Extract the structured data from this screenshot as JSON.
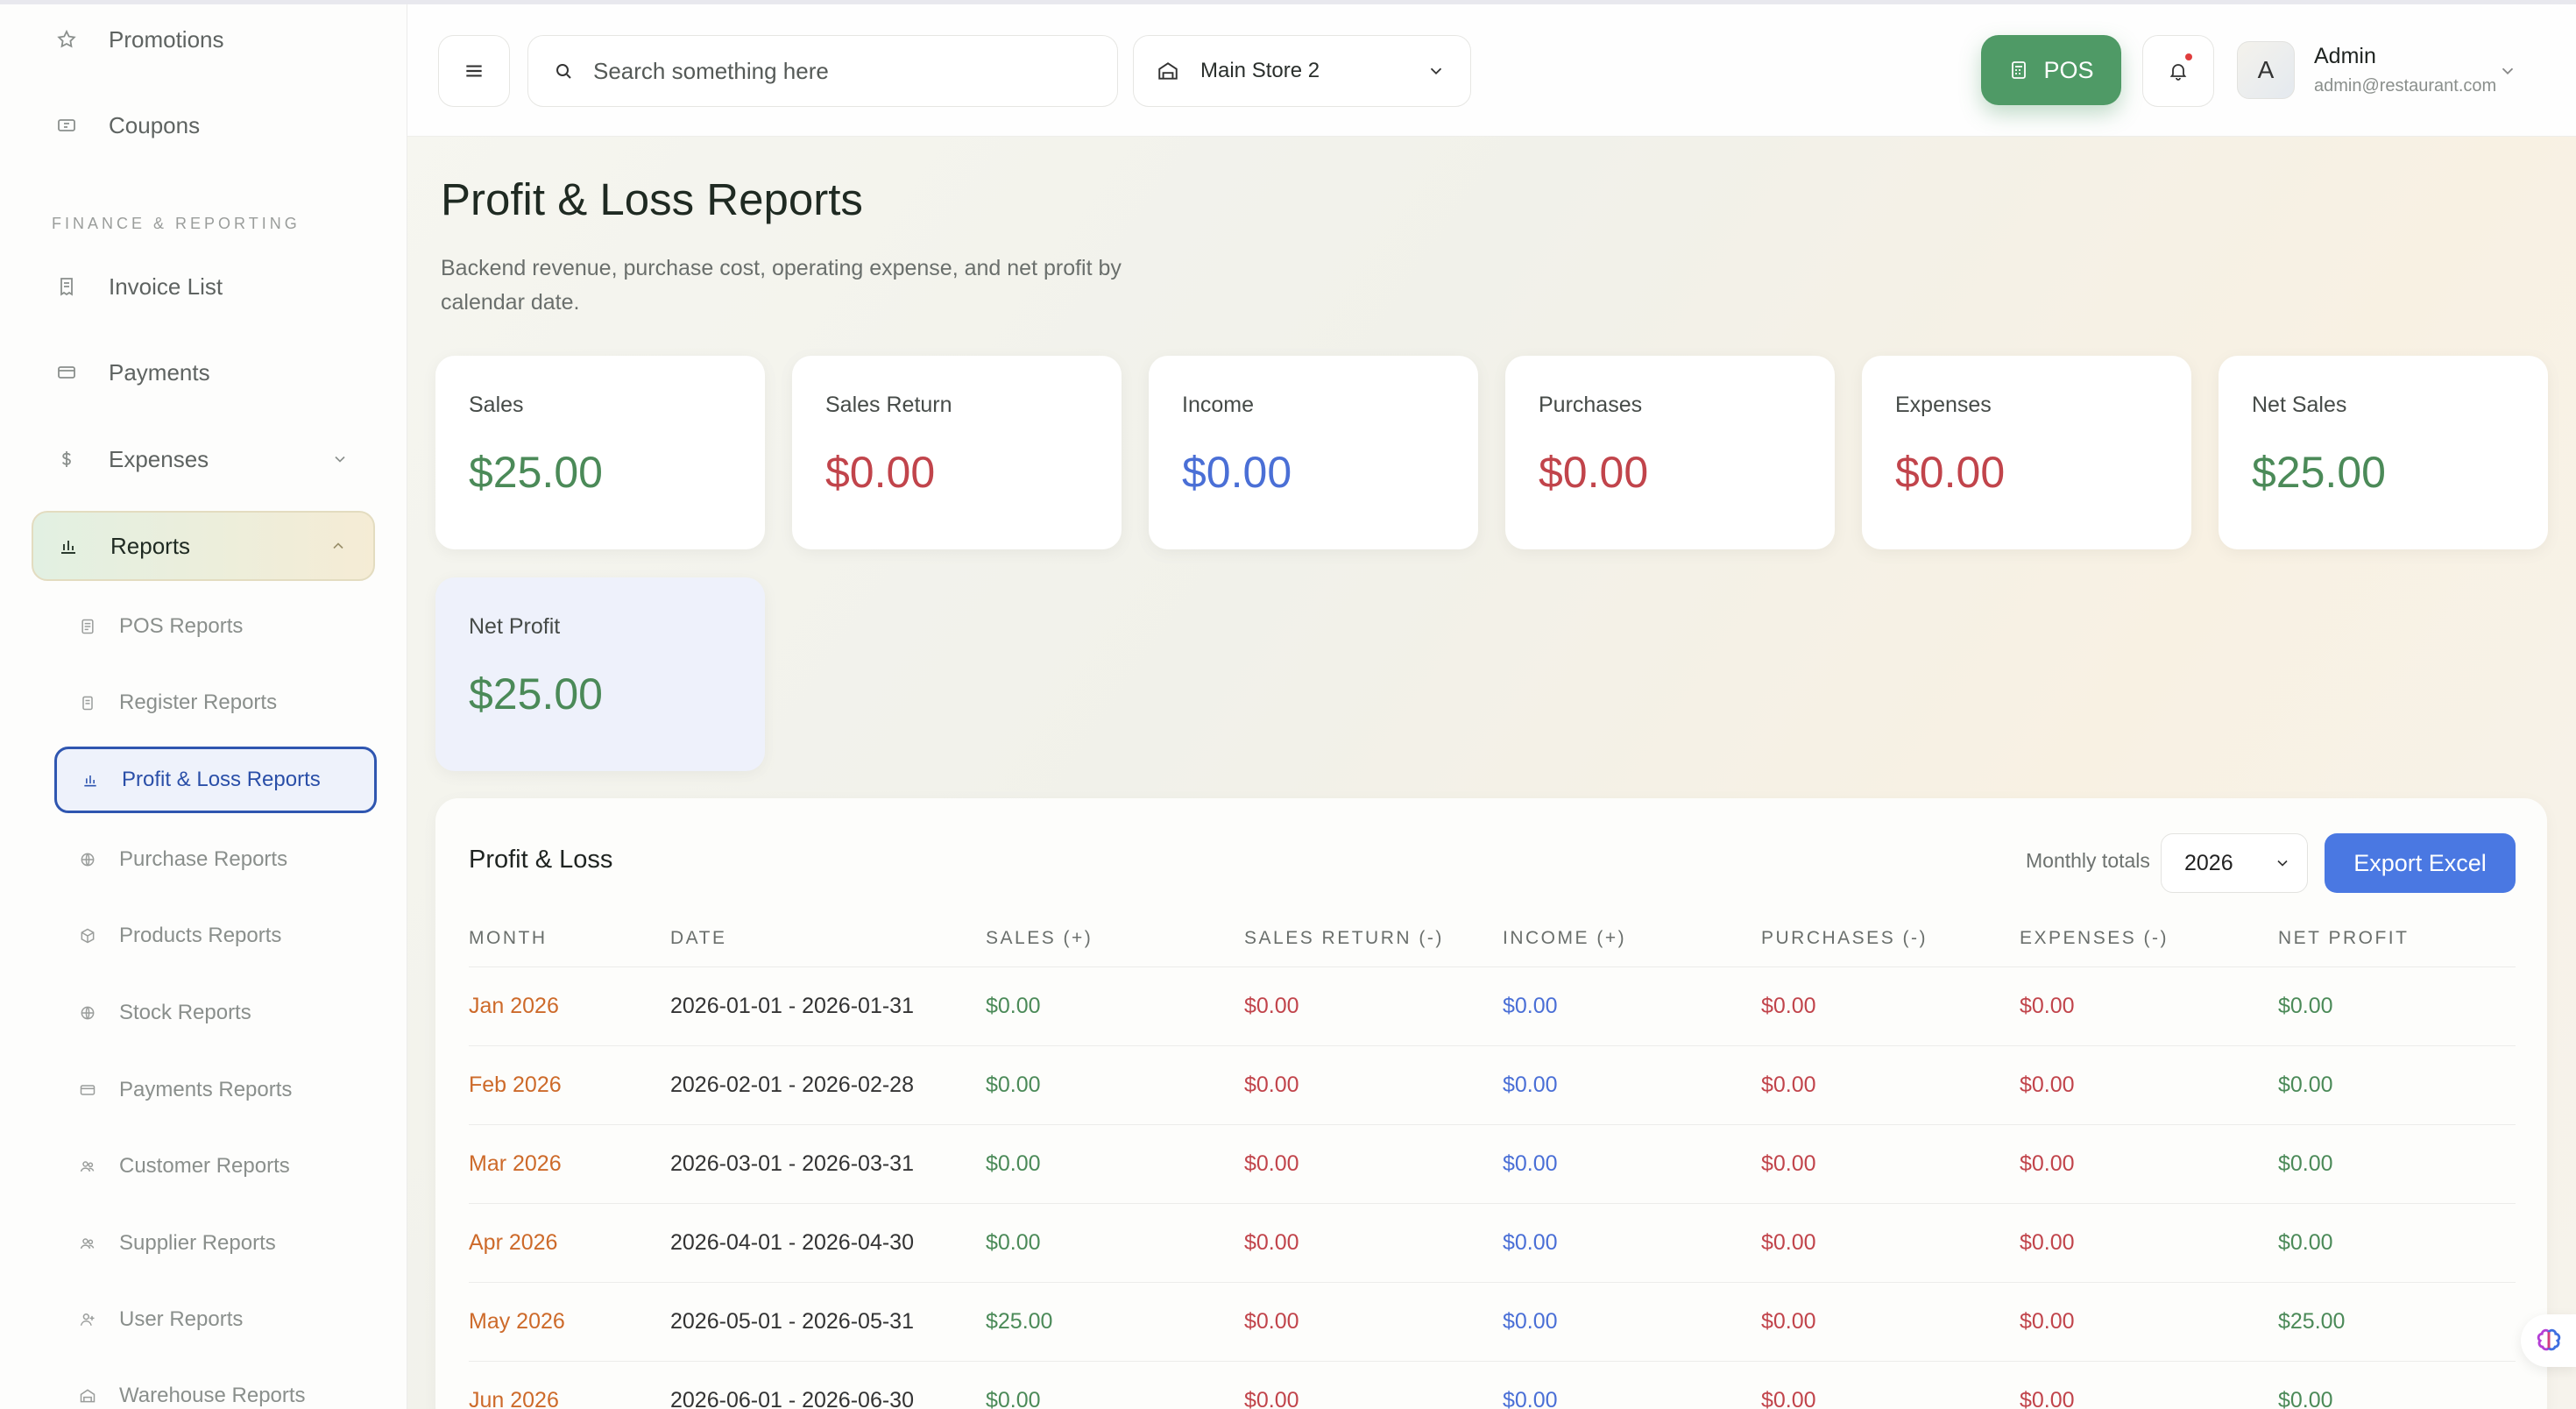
{
  "sidebar": {
    "top_items": [
      {
        "label": "Promotions",
        "icon": "star-icon"
      },
      {
        "label": "Coupons",
        "icon": "ticket-icon"
      }
    ],
    "section_title": "FINANCE & REPORTING",
    "items": [
      {
        "label": "Invoice List",
        "icon": "receipt-icon"
      },
      {
        "label": "Payments",
        "icon": "card-icon"
      },
      {
        "label": "Expenses",
        "icon": "dollar-icon"
      },
      {
        "label": "Reports",
        "icon": "bar-chart-icon"
      }
    ],
    "report_items": [
      {
        "label": "POS Reports"
      },
      {
        "label": "Register Reports"
      },
      {
        "label": "Profit & Loss Reports"
      },
      {
        "label": "Purchase Reports"
      },
      {
        "label": "Products Reports"
      },
      {
        "label": "Stock Reports"
      },
      {
        "label": "Payments Reports"
      },
      {
        "label": "Customer Reports"
      },
      {
        "label": "Supplier Reports"
      },
      {
        "label": "User Reports"
      },
      {
        "label": "Warehouse Reports"
      }
    ]
  },
  "topbar": {
    "search_placeholder": "Search something here",
    "store": "Main Store 2",
    "pos_label": "POS",
    "user_initial": "A",
    "user_name": "Admin",
    "user_email": "admin@restaurant.com"
  },
  "page": {
    "title": "Profit & Loss Reports",
    "subtitle": "Backend revenue, purchase cost, operating expense, and net profit by calendar date."
  },
  "cards": [
    {
      "label": "Sales",
      "value": "$25.00"
    },
    {
      "label": "Sales Return",
      "value": "$0.00"
    },
    {
      "label": "Income",
      "value": "$0.00"
    },
    {
      "label": "Purchases",
      "value": "$0.00"
    },
    {
      "label": "Expenses",
      "value": "$0.00"
    },
    {
      "label": "Net Sales",
      "value": "$25.00"
    },
    {
      "label": "Net Profit",
      "value": "$25.00"
    }
  ],
  "table": {
    "title": "Profit & Loss",
    "monthly_label": "Monthly totals",
    "year": "2026",
    "export_label": "Export Excel",
    "columns": [
      "MONTH",
      "DATE",
      "SALES (+)",
      "SALES RETURN (-)",
      "INCOME (+)",
      "PURCHASES (-)",
      "EXPENSES (-)",
      "NET PROFIT"
    ],
    "rows": [
      {
        "month": "Jan 2026",
        "date": "2026-01-01 - 2026-01-31",
        "sales": "$0.00",
        "sales_return": "$0.00",
        "income": "$0.00",
        "purchases": "$0.00",
        "expenses": "$0.00",
        "net_profit": "$0.00"
      },
      {
        "month": "Feb 2026",
        "date": "2026-02-01 - 2026-02-28",
        "sales": "$0.00",
        "sales_return": "$0.00",
        "income": "$0.00",
        "purchases": "$0.00",
        "expenses": "$0.00",
        "net_profit": "$0.00"
      },
      {
        "month": "Mar 2026",
        "date": "2026-03-01 - 2026-03-31",
        "sales": "$0.00",
        "sales_return": "$0.00",
        "income": "$0.00",
        "purchases": "$0.00",
        "expenses": "$0.00",
        "net_profit": "$0.00"
      },
      {
        "month": "Apr 2026",
        "date": "2026-04-01 - 2026-04-30",
        "sales": "$0.00",
        "sales_return": "$0.00",
        "income": "$0.00",
        "purchases": "$0.00",
        "expenses": "$0.00",
        "net_profit": "$0.00"
      },
      {
        "month": "May 2026",
        "date": "2026-05-01 - 2026-05-31",
        "sales": "$25.00",
        "sales_return": "$0.00",
        "income": "$0.00",
        "purchases": "$0.00",
        "expenses": "$0.00",
        "net_profit": "$25.00"
      },
      {
        "month": "Jun 2026",
        "date": "2026-06-01 - 2026-06-30",
        "sales": "$0.00",
        "sales_return": "$0.00",
        "income": "$0.00",
        "purchases": "$0.00",
        "expenses": "$0.00",
        "net_profit": "$0.00"
      }
    ]
  },
  "colors": {
    "accent_green": "#4f9a66",
    "positive": "#4b8a58",
    "negative": "#c1444b",
    "income": "#4a6fd6",
    "month": "#cd6a2a",
    "export_button": "#4a78e2"
  }
}
